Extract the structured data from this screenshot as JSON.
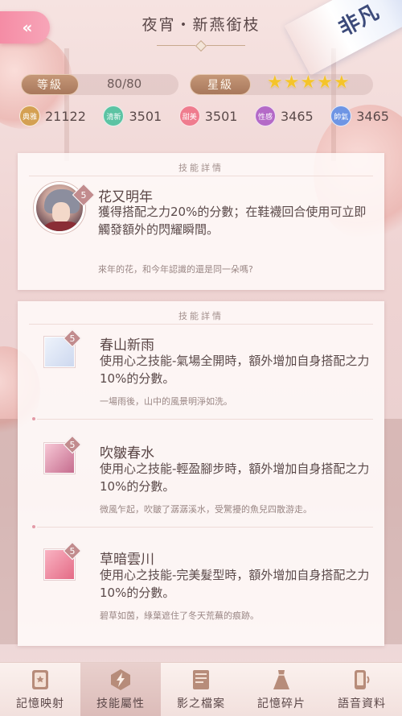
{
  "header": {
    "back_glyph": "«",
    "title": "夜宵・新燕銜枝",
    "corner_tag": "非凡"
  },
  "stats": {
    "level_label": "等級",
    "level_value": "80/80",
    "star_label": "星級",
    "stars": 5
  },
  "attributes": [
    {
      "label": "典雅",
      "value": "21122",
      "color": "#d4a052"
    },
    {
      "label": "清新",
      "value": "3501",
      "color": "#5cc3a3"
    },
    {
      "label": "甜美",
      "value": "3501",
      "color": "#ef7c8e"
    },
    {
      "label": "性感",
      "value": "3465",
      "color": "#b46ac7"
    },
    {
      "label": "帥氣",
      "value": "3465",
      "color": "#6e95e4"
    }
  ],
  "main_skill": {
    "header": "技能詳情",
    "level": "5",
    "name": "花又明年",
    "description": "獲得搭配之力20%的分數；在鞋襪回合使用可立即觸發額外的閃耀瞬間。",
    "flavor": "來年的花，和今年認識的還是同一朵嗎?"
  },
  "sub_skills_header": "技能詳情",
  "sub_skills": [
    {
      "level": "5",
      "name": "春山新雨",
      "description": "使用心之技能-氣場全開時，額外增加自身搭配之力10%的分數。",
      "flavor": "一場雨後，山中的風景明淨如洗。",
      "icon_color": "#d9e6f7"
    },
    {
      "level": "5",
      "name": "吹皺春水",
      "description": "使用心之技能-輕盈腳步時，額外增加自身搭配之力10%的分數。",
      "flavor": "微風乍起，吹皺了潺潺溪水，受驚擾的魚兒四散游走。",
      "icon_color": "#e7b0c3"
    },
    {
      "level": "5",
      "name": "草暗雲川",
      "description": "使用心之技能-完美髮型時，額外增加自身搭配之力10%的分數。",
      "flavor": "碧草如茵，綠葉遮住了冬天荒蕪的痕跡。",
      "icon_color": "#f08aa0"
    }
  ],
  "nav": [
    {
      "label": "記憶映射",
      "icon": "memory-card-icon",
      "active": false
    },
    {
      "label": "技能屬性",
      "icon": "skill-lightning-icon",
      "active": true
    },
    {
      "label": "影之檔案",
      "icon": "document-icon",
      "active": false
    },
    {
      "label": "記憶碎片",
      "icon": "dress-icon",
      "active": false
    },
    {
      "label": "語音資料",
      "icon": "voice-phone-icon",
      "active": false
    }
  ]
}
